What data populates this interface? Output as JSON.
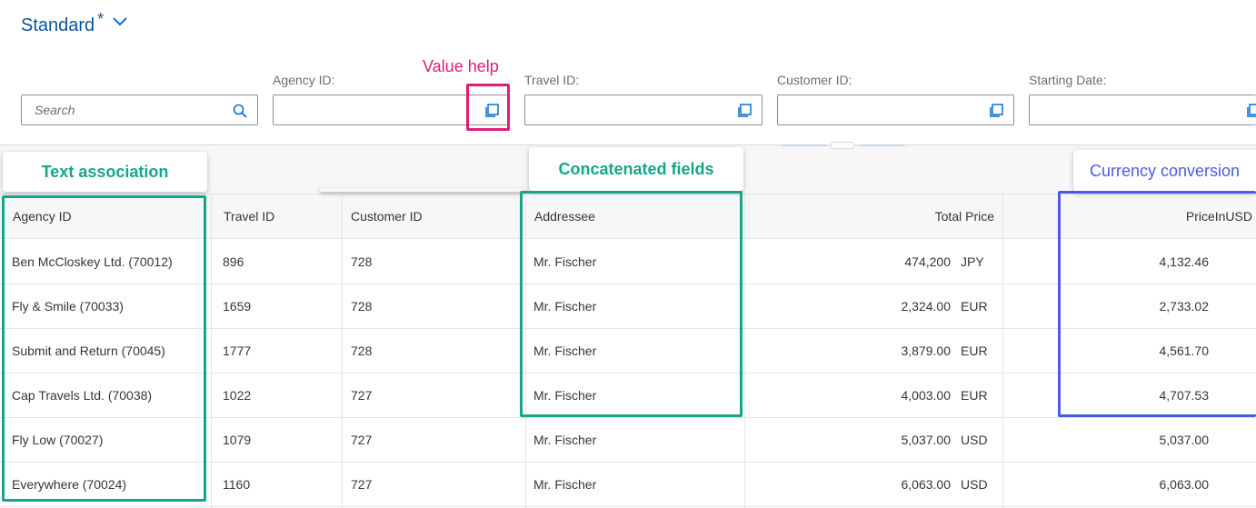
{
  "variant": {
    "title": "Standard",
    "modified": "*"
  },
  "annotations": {
    "value_help": "Value help",
    "text_association": "Text association",
    "concatenated_fields": "Concatenated fields",
    "currency_conversion": "Currency conversion"
  },
  "filter_bar": {
    "search": {
      "placeholder": "Search",
      "value": ""
    },
    "fields": [
      {
        "label": "Agency ID:",
        "value": ""
      },
      {
        "label": "Travel ID:",
        "value": ""
      },
      {
        "label": "Customer ID:",
        "value": ""
      },
      {
        "label": "Starting Date:",
        "value": ""
      }
    ]
  },
  "table": {
    "columns": [
      "Agency ID",
      "Travel ID",
      "Customer ID",
      "Addressee",
      "Total Price",
      "PriceInUSD"
    ],
    "rows": [
      {
        "agency": "Ben McCloskey Ltd. (70012)",
        "travel": "896",
        "customer": "728",
        "addressee": "Mr. Fischer",
        "price": "474,200",
        "currency": "JPY",
        "usd": "4,132.46"
      },
      {
        "agency": "Fly & Smile (70033)",
        "travel": "1659",
        "customer": "728",
        "addressee": "Mr. Fischer",
        "price": "2,324.00",
        "currency": "EUR",
        "usd": "2,733.02"
      },
      {
        "agency": "Submit and Return (70045)",
        "travel": "1777",
        "customer": "728",
        "addressee": "Mr. Fischer",
        "price": "3,879.00",
        "currency": "EUR",
        "usd": "4,561.70"
      },
      {
        "agency": "Cap Travels Ltd. (70038)",
        "travel": "1022",
        "customer": "727",
        "addressee": "Mr. Fischer",
        "price": "4,003.00",
        "currency": "EUR",
        "usd": "4,707.53"
      },
      {
        "agency": "Fly Low (70027)",
        "travel": "1079",
        "customer": "727",
        "addressee": "Mr. Fischer",
        "price": "5,037.00",
        "currency": "USD",
        "usd": "5,037.00"
      },
      {
        "agency": "Everywhere (70024)",
        "travel": "1160",
        "customer": "727",
        "addressee": "Mr. Fischer",
        "price": "6,063.00",
        "currency": "USD",
        "usd": "6,063.00"
      }
    ]
  },
  "colors": {
    "brand_blue": "#0a6ed1",
    "value_help_pink": "#e01c7a",
    "annotation_green": "#17a58a",
    "annotation_blue": "#4a5be8"
  },
  "icons": {
    "variant_chevron": "chevron-down-icon",
    "search": "search-icon",
    "value_help": "value-help-icon"
  }
}
